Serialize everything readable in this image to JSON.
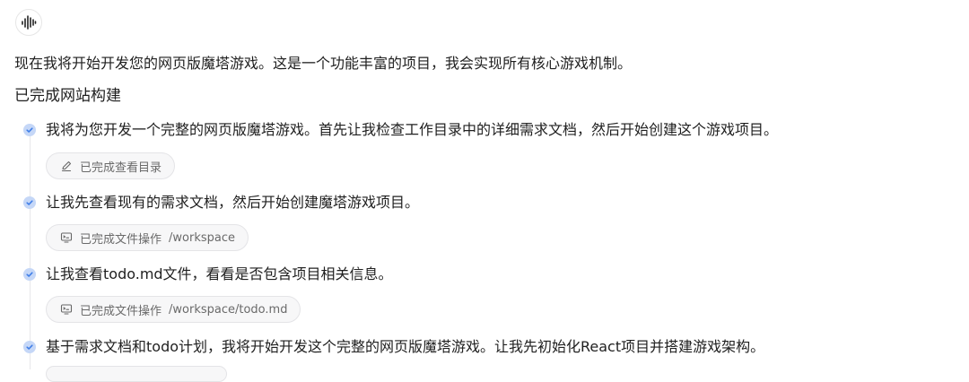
{
  "assistant": {
    "avatar_icon": "waveform-logo-icon"
  },
  "message": {
    "intro": "现在我将开始开发您的网页版魔塔游戏。这是一个功能丰富的项目，我会实现所有核心游戏机制。",
    "section_title": "已完成网站构建"
  },
  "steps": [
    {
      "text": "我将为您开发一个完整的网页版魔塔游戏。首先让我检查工作目录中的详细需求文档，然后开始创建这个游戏项目。",
      "chip": {
        "icon": "edit-pencil-icon",
        "label": "已完成查看目录",
        "path": ""
      }
    },
    {
      "text": "让我先查看现有的需求文档，然后开始创建魔塔游戏项目。",
      "chip": {
        "icon": "terminal-monitor-icon",
        "label": "已完成文件操作",
        "path": "/workspace"
      }
    },
    {
      "text": "让我查看todo.md文件，看看是否包含项目相关信息。",
      "chip": {
        "icon": "terminal-monitor-icon",
        "label": "已完成文件操作",
        "path": "/workspace/todo.md"
      }
    },
    {
      "text": "基于需求文档和todo计划，我将开始开发这个完整的网页版魔塔游戏。让我先初始化React项目并搭建游戏架构。"
    }
  ],
  "colors": {
    "dot": "#c5d7f7",
    "check": "#3f7ee8",
    "chip_bg": "#f7f7f8",
    "chip_border": "#e4e4e7"
  }
}
